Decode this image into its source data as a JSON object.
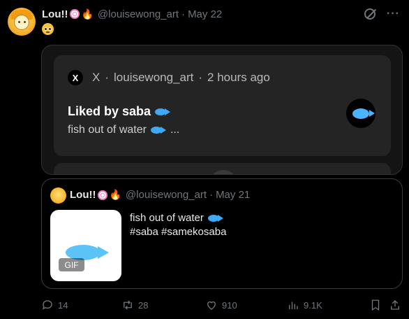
{
  "post": {
    "author_name": "Lou!!",
    "author_emojis": [
      "lollipop-emoji",
      "fire-emoji"
    ],
    "handle": "@louisewong_art",
    "separator": "·",
    "date": "May 22",
    "text_emoji": "pleading-face-emoji"
  },
  "media_card": {
    "notification": {
      "app_glyph": "X",
      "source_app": "X",
      "source_handle": "louisewong_art",
      "time_ago": "2 hours ago",
      "title": "Liked by saba",
      "body": "fish out of water",
      "ellipsis": "..."
    }
  },
  "quoted_post": {
    "author_name": "Lou!!",
    "handle": "@louisewong_art",
    "separator": "·",
    "date": "May 21",
    "gif_badge": "GIF",
    "text_line1": "fish out of water",
    "text_line2": "#saba #samekosaba"
  },
  "actions": {
    "replies": "14",
    "reposts": "28",
    "likes": "910",
    "views": "9.1K"
  },
  "icons": [
    "grok-icon",
    "more-icon",
    "reply-icon",
    "repost-icon",
    "like-icon",
    "views-icon",
    "bookmark-icon",
    "share-icon"
  ],
  "colors": {
    "background": "#000000",
    "muted": "#71767b",
    "fish_blue": "#3fa9f5"
  }
}
